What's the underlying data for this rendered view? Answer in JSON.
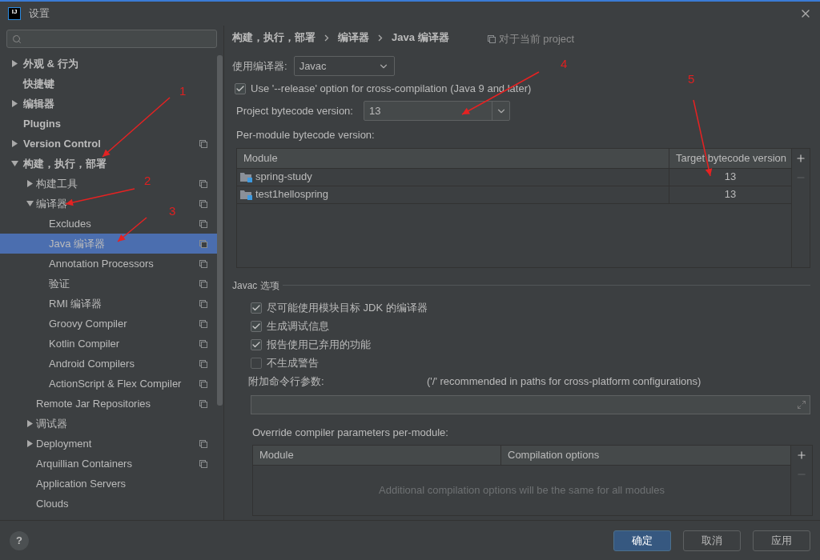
{
  "window": {
    "logo_text": "IJ",
    "title": "设置"
  },
  "sidebar": {
    "items": [
      {
        "label": "外观 & 行为",
        "expanded": false,
        "project_icon": false,
        "selected": false
      },
      {
        "label": "快捷键",
        "project_icon": false,
        "selected": false
      },
      {
        "label": "编辑器",
        "expanded": false,
        "project_icon": false,
        "selected": false
      },
      {
        "label": "Plugins",
        "project_icon": false,
        "selected": false
      },
      {
        "label": "Version Control",
        "expanded": false,
        "project_icon": true,
        "selected": false
      },
      {
        "label": "构建，执行，部署",
        "expanded": true,
        "project_icon": false,
        "selected": false,
        "children": [
          {
            "label": "构建工具",
            "expanded": false,
            "project_icon": true,
            "selected": false
          },
          {
            "label": "编译器",
            "expanded": true,
            "project_icon": true,
            "selected": false,
            "children": [
              {
                "label": "Excludes",
                "project_icon": true,
                "selected": false
              },
              {
                "label": "Java 编译器",
                "project_icon": true,
                "selected": true
              },
              {
                "label": "Annotation Processors",
                "project_icon": true,
                "selected": false
              },
              {
                "label": "验证",
                "project_icon": true,
                "selected": false
              },
              {
                "label": "RMI 编译器",
                "project_icon": true,
                "selected": false
              },
              {
                "label": "Groovy Compiler",
                "project_icon": true,
                "selected": false
              },
              {
                "label": "Kotlin Compiler",
                "project_icon": true,
                "selected": false
              },
              {
                "label": "Android Compilers",
                "project_icon": true,
                "selected": false
              },
              {
                "label": "ActionScript & Flex Compiler",
                "project_icon": true,
                "selected": false
              }
            ]
          },
          {
            "label": "Remote Jar Repositories",
            "project_icon": true,
            "selected": false
          },
          {
            "label": "调试器",
            "expanded": false,
            "project_icon": false,
            "selected": false
          },
          {
            "label": "Deployment",
            "expanded": false,
            "project_icon": true,
            "selected": false
          },
          {
            "label": "Arquillian Containers",
            "project_icon": true,
            "selected": false
          },
          {
            "label": "Application Servers",
            "project_icon": false,
            "selected": false
          },
          {
            "label": "Clouds",
            "project_icon": false,
            "selected": false
          }
        ]
      }
    ]
  },
  "breadcrumb": [
    "构建，执行，部署",
    "编译器",
    "Java 编译器"
  ],
  "scope_note": "对于当前 project",
  "compiler": {
    "label": "使用编译器:",
    "value": "Javac"
  },
  "release_option": {
    "label": "Use '--release' option for cross-compilation (Java 9 and later)",
    "checked": true
  },
  "project_bytecode": {
    "label": "Project bytecode version:",
    "value": "13"
  },
  "per_module": {
    "label": "Per-module bytecode version:",
    "columns": [
      "Module",
      "Target bytecode version"
    ],
    "rows": [
      {
        "module": "spring-study",
        "version": "13"
      },
      {
        "module": "test1hellospring",
        "version": "13"
      }
    ]
  },
  "javac": {
    "title": "Javac 选项",
    "options": [
      {
        "label": "尽可能使用模块目标 JDK 的编译器",
        "checked": true
      },
      {
        "label": "生成调试信息",
        "checked": true
      },
      {
        "label": "报告使用已弃用的功能",
        "checked": true
      },
      {
        "label": "不生成警告",
        "checked": false
      }
    ],
    "args_label": "附加命令行参数:",
    "args_hint": "('/' recommended in paths for cross-platform configurations)"
  },
  "override": {
    "label": "Override compiler parameters per-module:",
    "columns": [
      "Module",
      "Compilation options"
    ],
    "empty_text": "Additional compilation options will be the same for all modules"
  },
  "help": "?",
  "buttons": [
    {
      "label": "确定",
      "primary": true
    },
    {
      "label": "取消",
      "primary": false
    },
    {
      "label": "应用",
      "primary": false
    }
  ],
  "annotations": [
    {
      "label": "1"
    },
    {
      "label": "2"
    },
    {
      "label": "3"
    },
    {
      "label": "4"
    },
    {
      "label": "5"
    }
  ]
}
